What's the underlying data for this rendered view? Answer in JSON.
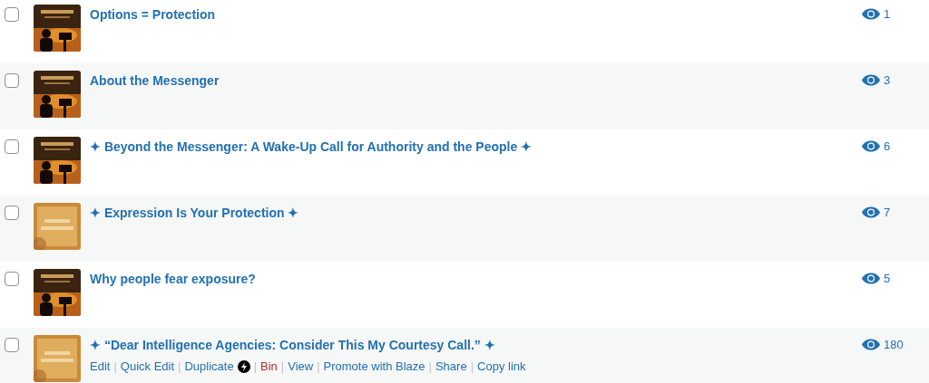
{
  "posts": [
    {
      "title": "Options = Protection",
      "kind": "silhouette",
      "checked": false,
      "views": "1"
    },
    {
      "title": "About the Messenger",
      "kind": "silhouette",
      "checked": false,
      "views": "3"
    },
    {
      "title": "✦ Beyond the Messenger: A Wake-Up Call for Authority and the People ✦",
      "kind": "silhouette",
      "checked": false,
      "views": "6"
    },
    {
      "title": "✦ Expression Is Your Protection ✦",
      "kind": "parchment",
      "checked": false,
      "views": "7"
    },
    {
      "title": "Why people fear exposure?",
      "kind": "silhouette",
      "checked": false,
      "views": "5"
    },
    {
      "title": "✦ “Dear Intelligence Agencies: Consider This My Courtesy Call.” ✦",
      "kind": "parchment",
      "checked": false,
      "views": "180",
      "actions": [
        {
          "label": "Edit",
          "kind": "link",
          "badge": false
        },
        {
          "label": "|",
          "kind": "separator"
        },
        {
          "label": "Quick Edit",
          "kind": "link",
          "badge": false
        },
        {
          "label": "|",
          "kind": "separator"
        },
        {
          "label": "Duplicate",
          "kind": "link",
          "badge": true
        },
        {
          "label": "|",
          "kind": "separator"
        },
        {
          "label": "Bin",
          "kind": "danger",
          "badge": false
        },
        {
          "label": "|",
          "kind": "separator"
        },
        {
          "label": "View",
          "kind": "link",
          "badge": false
        },
        {
          "label": "|",
          "kind": "separator"
        },
        {
          "label": "Promote with Blaze",
          "kind": "link",
          "badge": false
        },
        {
          "label": "|",
          "kind": "separator"
        },
        {
          "label": "Share",
          "kind": "link",
          "badge": false
        },
        {
          "label": "|",
          "kind": "separator"
        },
        {
          "label": "Copy link",
          "kind": "link",
          "badge": false
        }
      ]
    }
  ]
}
